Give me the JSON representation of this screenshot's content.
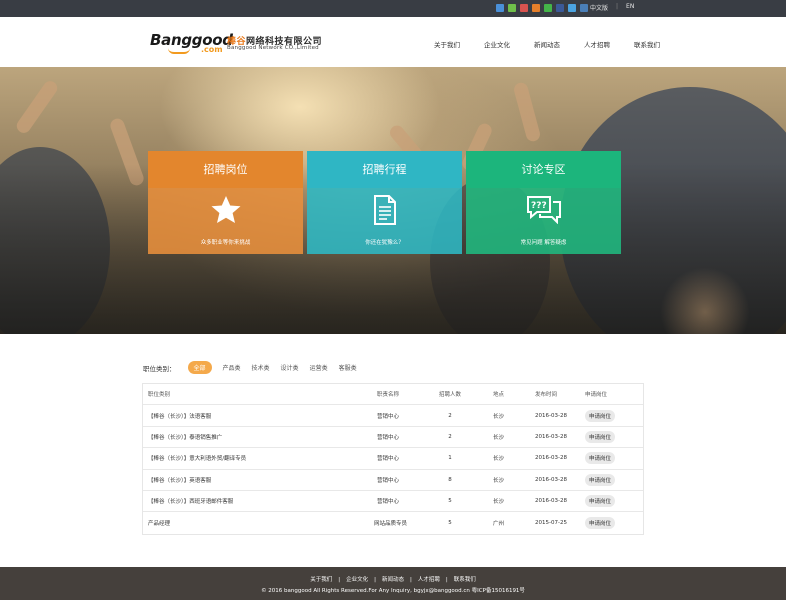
{
  "topbar": {
    "social_icons": [
      {
        "name": "qzone-icon",
        "color": "#4a90d9"
      },
      {
        "name": "tencent-weibo-icon",
        "color": "#6fbf4a"
      },
      {
        "name": "sina-weibo-icon",
        "color": "#d9534f"
      },
      {
        "name": "renren-icon",
        "color": "#e57f2b"
      },
      {
        "name": "wechat-icon",
        "color": "#44b549"
      },
      {
        "name": "facebook-icon",
        "color": "#3b5998"
      },
      {
        "name": "twitter-icon",
        "color": "#4ba3e0"
      },
      {
        "name": "linkedin-icon",
        "color": "#4a7fb8"
      }
    ],
    "lang_cn": "中文版",
    "lang_sep": "|",
    "lang_en": "EN"
  },
  "header": {
    "logo_text_1": "Ban",
    "logo_text_2": "g",
    "logo_text_3": "good",
    "logo_com": ".com",
    "company_cn_hl": "棒谷",
    "company_cn_rest": "网络科技有限公司",
    "company_en": "Banggood Network CO.,Limited",
    "nav": [
      "关于我们",
      "企业文化",
      "新闻动态",
      "人才招聘",
      "联系我们"
    ]
  },
  "cards": [
    {
      "title": "招聘岗位",
      "icon": "star-icon",
      "desc": "众多职业等你来挑战"
    },
    {
      "title": "招聘行程",
      "icon": "document-icon",
      "desc": "你还在犹豫么？"
    },
    {
      "title": "讨论专区",
      "icon": "chat-bubble-icon",
      "desc": "常见问题 解答疑虑"
    }
  ],
  "filter": {
    "label": "职位类别：",
    "tags": [
      "全部",
      "产品类",
      "技术类",
      "设计类",
      "运营类",
      "客服类"
    ],
    "active_index": 0
  },
  "table": {
    "headers": [
      "职位类别",
      "职责名称",
      "招聘人数",
      "地点",
      "发布时间",
      "申请岗位"
    ],
    "rows": [
      [
        "【棒谷（长沙）】法语客服",
        "营销中心",
        "2",
        "长沙",
        "2016-03-28",
        "申请岗位"
      ],
      [
        "【棒谷（长沙）】泰语销售推广",
        "营销中心",
        "2",
        "长沙",
        "2016-03-28",
        "申请岗位"
      ],
      [
        "【棒谷（长沙）】意大利语外贸/翻译专员",
        "营销中心",
        "1",
        "长沙",
        "2016-03-28",
        "申请岗位"
      ],
      [
        "【棒谷（长沙）】英语客服",
        "营销中心",
        "8",
        "长沙",
        "2016-03-28",
        "申请岗位"
      ],
      [
        "【棒谷（长沙）】西班牙语邮件客服",
        "营销中心",
        "5",
        "长沙",
        "2016-03-28",
        "申请岗位"
      ],
      [
        "产品经理",
        "网站品质专员",
        "5",
        "广州",
        "2015-07-25",
        "申请岗位"
      ]
    ]
  },
  "footer": {
    "nav": [
      "关于我们",
      "企业文化",
      "新闻动态",
      "人才招聘",
      "联系我们"
    ],
    "sep": "|",
    "copyright": "© 2016 banggood All Rights Reserved.For Any Inquiry, bgyjx@banggood.cn  粤ICP备15016191号"
  },
  "colors": {
    "orange": "#e3862d",
    "teal": "#2fb6c4",
    "green": "#1cb57c",
    "footer_bg": "#45403c",
    "topbar_bg": "#393d44",
    "accent": "#f4a94b"
  }
}
